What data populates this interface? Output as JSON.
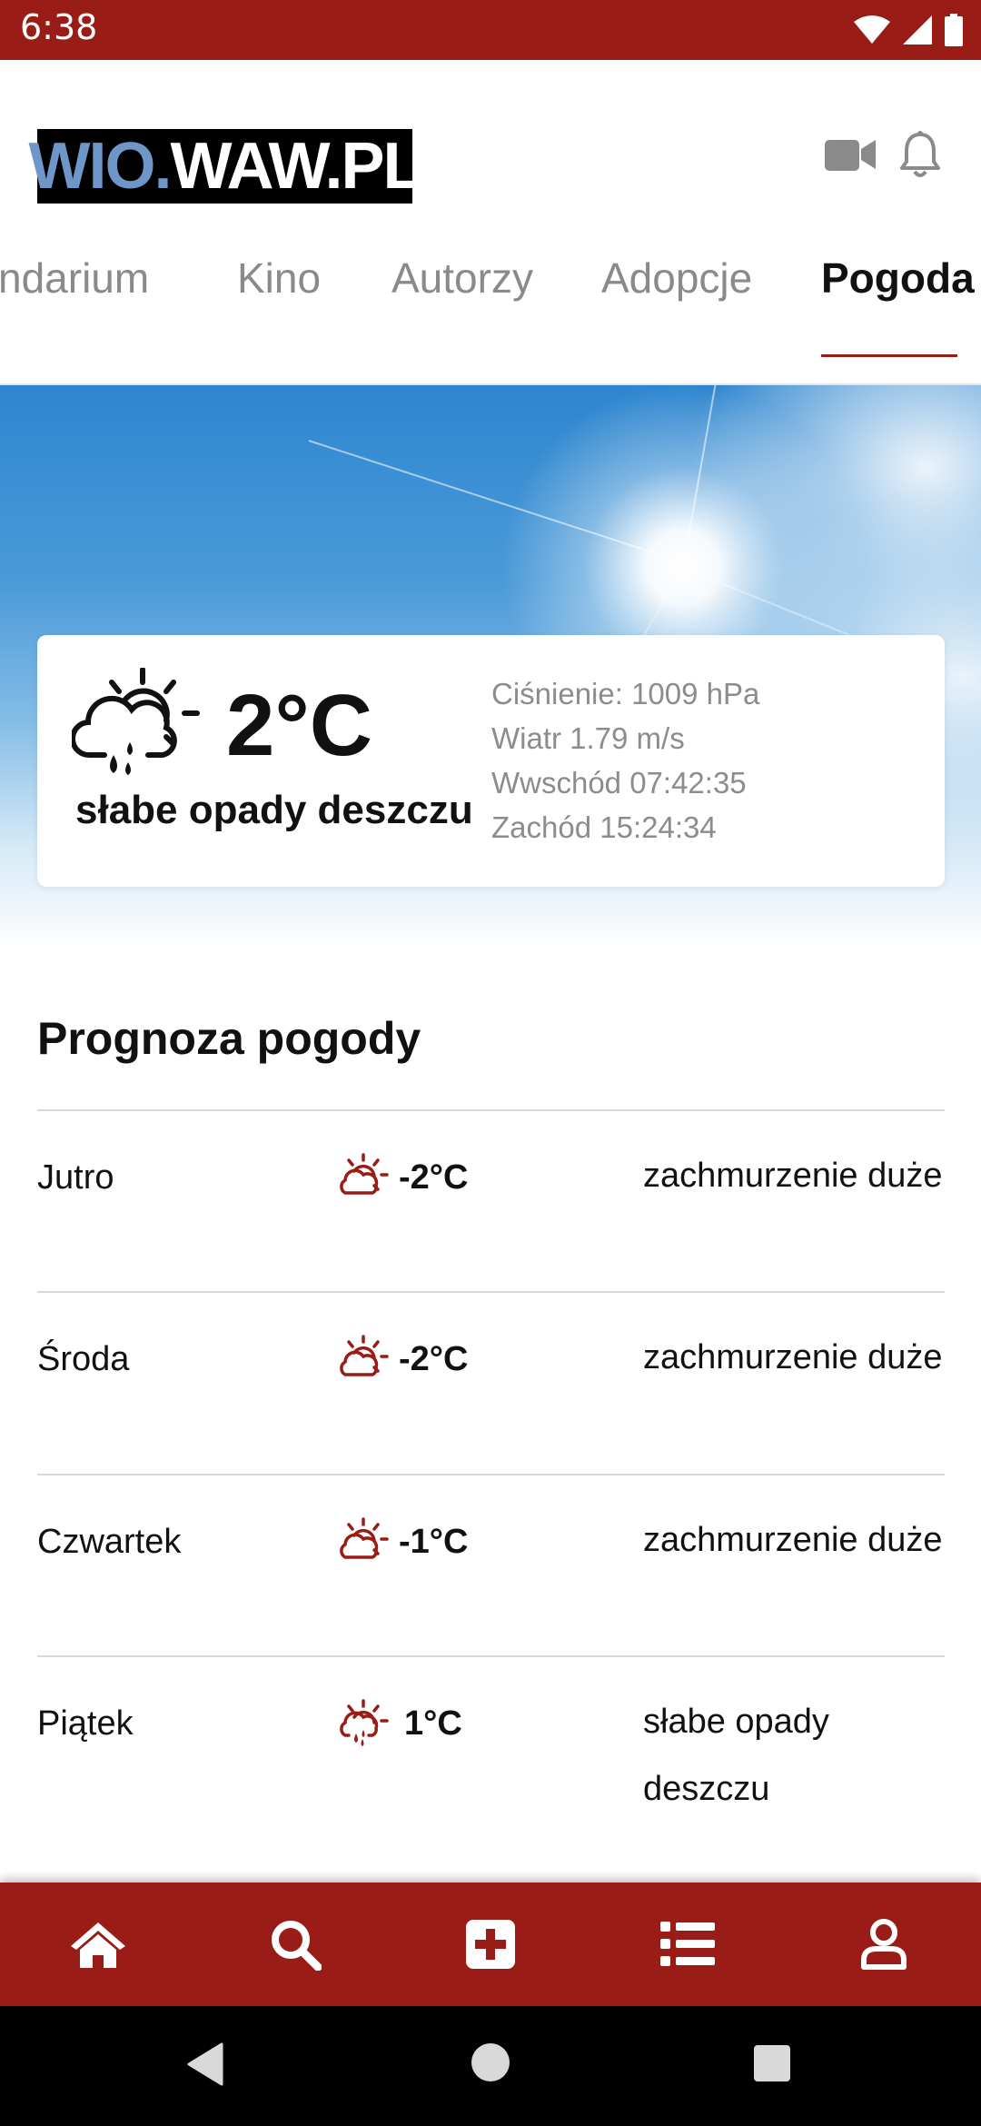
{
  "status_bar": {
    "time": "6:38"
  },
  "header": {
    "logo_part1": "WIO.",
    "logo_part2": "WAW.PL"
  },
  "tabs": [
    {
      "label": "Kalendarium",
      "visible_label": "ndarium"
    },
    {
      "label": "Kino"
    },
    {
      "label": "Autorzy"
    },
    {
      "label": "Adopcje"
    },
    {
      "label": "Pogoda",
      "active": true
    }
  ],
  "current_weather": {
    "temp": "2°C",
    "description": "słabe opady deszczu",
    "pressure": "Ciśnienie: 1009 hPa",
    "wind": "Wiatr 1.79 m/s",
    "sunrise": "Wwschód 07:42:35",
    "sunset": "Zachód 15:24:34",
    "icon": "cloud-rain-sun-icon"
  },
  "forecast": {
    "title": "Prognoza pogody",
    "rows": [
      {
        "day": "Jutro",
        "temp": "-2°C",
        "description": "zachmurzenie duże",
        "icon": "cloud-sun-icon"
      },
      {
        "day": "Środa",
        "temp": "-2°C",
        "description": "zachmurzenie duże",
        "icon": "cloud-sun-icon"
      },
      {
        "day": "Czwartek",
        "temp": "-1°C",
        "description": "zachmurzenie duże",
        "icon": "cloud-sun-icon"
      },
      {
        "day": "Piątek",
        "temp": "1°C",
        "description": "słabe opady deszczu",
        "icon": "cloud-rain-sun-icon"
      }
    ]
  },
  "bottom_nav": [
    "home-icon",
    "search-icon",
    "plus-square-icon",
    "list-icon",
    "user-icon"
  ],
  "colors": {
    "brand": "#9a1c17",
    "accent_icon": "#9a1c17"
  }
}
